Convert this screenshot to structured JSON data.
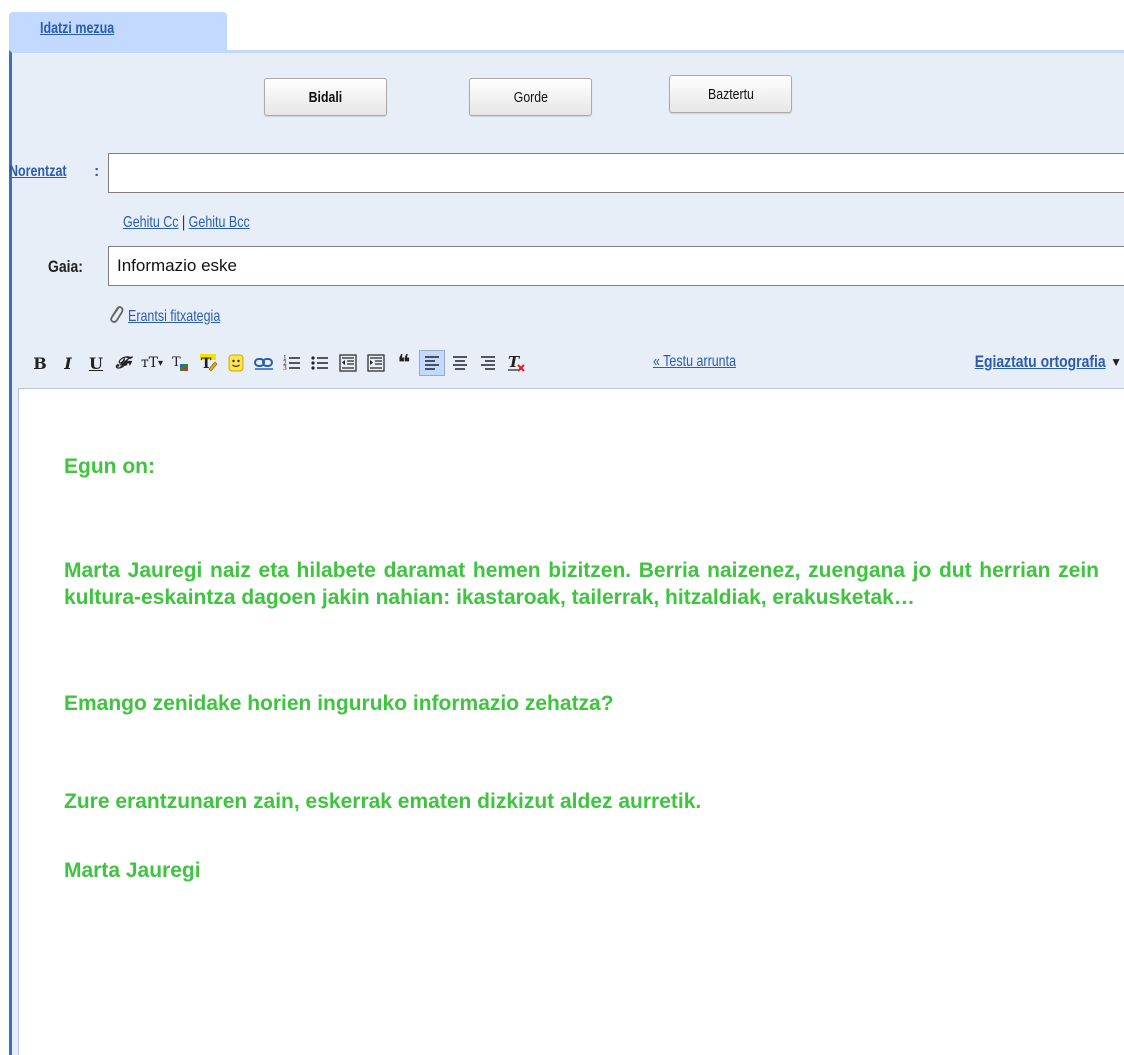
{
  "tab": {
    "label": "Idatzi mezua"
  },
  "actions": {
    "send": "Bidali",
    "save": "Gorde",
    "discard": "Baztertu"
  },
  "to": {
    "label": "Norentzat",
    "colon": ":",
    "value": ""
  },
  "cc_bcc": {
    "cc": "Gehitu Cc",
    "separator": " | ",
    "bcc": "Gehitu Bcc"
  },
  "subject": {
    "label": "Gaia:",
    "value": "Informazio eske"
  },
  "attach": {
    "label": "Erantsi fitxategia",
    "icon": "paperclip-icon"
  },
  "toolbar": {
    "plain_text_link": "« Testu arrunta",
    "spellcheck": "Egiaztatu ortografia",
    "spellcheck_arrow": "▼",
    "buttons": [
      "bold",
      "italic",
      "underline",
      "font",
      "font-size",
      "text-color",
      "highlight-color",
      "emoticon",
      "link",
      "numbered-list",
      "bulleted-list",
      "outdent",
      "indent",
      "quote",
      "align-left",
      "align-center",
      "align-right",
      "remove-formatting"
    ]
  },
  "body": {
    "greeting": "Egun on:",
    "paragraph": "Marta Jauregi naiz eta hilabete daramat hemen bizitzen. Berria naizenez, zuengana jo dut herrian zein kultura-eskaintza dagoen jakin nahian: ikastaroak, tailerrak, hitzaldiak, erakusketak…",
    "question": "Emango zenidake horien inguruko informazio zehatza?",
    "thanks": "Zure erantzunaren zain, eskerrak ematen dizkizut aldez aurretik.",
    "signature": "Marta Jauregi"
  },
  "colors": {
    "link": "#2a5db0",
    "panel": "#e8eef7",
    "tab": "#c3d9ff",
    "body_text": "#3ec43e"
  }
}
